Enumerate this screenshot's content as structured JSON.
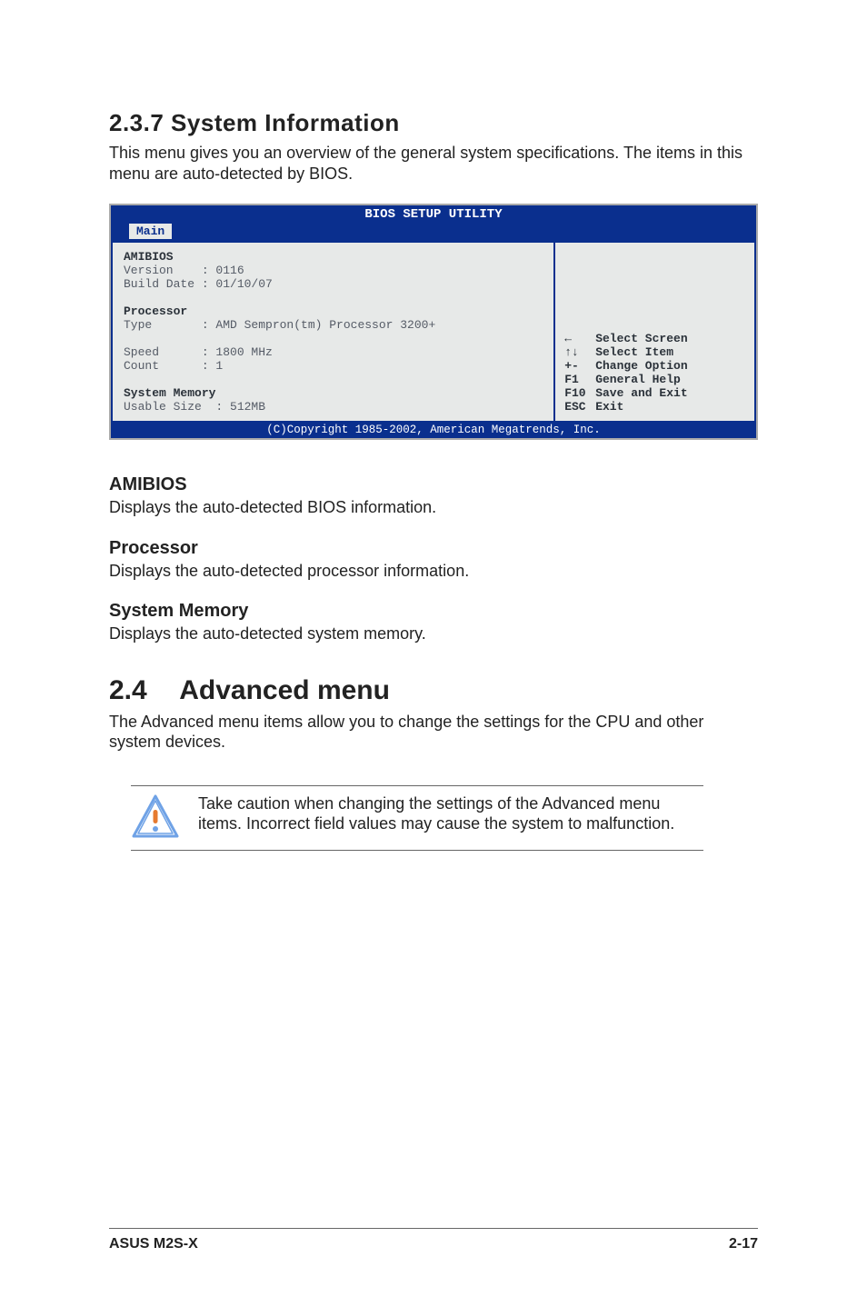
{
  "section": {
    "number_title": "2.3.7   System Information",
    "intro": "This menu gives you an overview of the general system specifications. The items in this menu are auto-detected by BIOS."
  },
  "bios": {
    "title": "BIOS SETUP UTILITY",
    "tab": "Main",
    "left": {
      "amibios_label": "AMIBIOS",
      "version_line": "Version    : 0116",
      "build_line": "Build Date : 01/10/07",
      "proc_label": "Processor",
      "type_line": "Type       : AMD Sempron(tm) Processor 3200+",
      "speed_line": "Speed      : 1800 MHz",
      "count_line": "Count      : 1",
      "mem_label": "System Memory",
      "usable_line": "Usable Size  : 512MB"
    },
    "hints": {
      "k0": "←",
      "v0": "Select Screen",
      "k1": "↑↓",
      "v1": "Select Item",
      "k2": "+-",
      "v2": "Change Option",
      "k3": "F1",
      "v3": "General Help",
      "k4": "F10",
      "v4": "Save and Exit",
      "k5": "ESC",
      "v5": "Exit"
    },
    "copyright": "(C)Copyright 1985-2002, American Megatrends, Inc."
  },
  "subs": {
    "amibios_h": "AMIBIOS",
    "amibios_p": "Displays the auto-detected BIOS information.",
    "proc_h": "Processor",
    "proc_p": "Displays the auto-detected processor information.",
    "mem_h": "System Memory",
    "mem_p": "Displays the auto-detected system memory."
  },
  "advanced": {
    "num": "2.4",
    "title": "Advanced menu",
    "intro": "The Advanced menu items allow you to change the settings for the CPU and other system devices.",
    "callout": "Take caution when changing the settings of the Advanced menu items. Incorrect field values may cause the system to malfunction."
  },
  "footer": {
    "left": "ASUS M2S-X",
    "right": "2-17"
  }
}
